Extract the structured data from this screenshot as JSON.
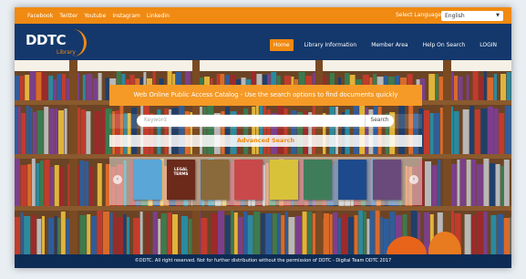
{
  "topbar": {
    "social_links": [
      "Facebook",
      "Twitter",
      "Youtube",
      "Instagram",
      "Linkedin"
    ],
    "language_label": "Select Language",
    "language_value": "English"
  },
  "logo": {
    "word": "DDTC",
    "sub": "Library"
  },
  "nav": {
    "items": [
      "Home",
      "Library Information",
      "Member Area",
      "Help On Search",
      "LOGIN"
    ],
    "active": "Home"
  },
  "banner": {
    "text": "Web Online Public Access Catalog - Use the search options to find documents quickly"
  },
  "search": {
    "placeholder": "Keyword",
    "button": "Search"
  },
  "advanced_search": "Advanced Search",
  "carousel": {
    "books": [
      {
        "title": "",
        "color": "#5aa6d6"
      },
      {
        "title": "LEGAL TERMS",
        "color": "#6b2a1a"
      },
      {
        "title": "",
        "color": "#8a6a3a"
      },
      {
        "title": "",
        "color": "#c9494b"
      },
      {
        "title": "",
        "color": "#d8c23a"
      },
      {
        "title": "",
        "color": "#3f7d5a"
      },
      {
        "title": "",
        "color": "#1d4a8c"
      },
      {
        "title": "",
        "color": "#6a4a7a"
      }
    ]
  },
  "footer": {
    "text": "©DDTC. All right reserved. Not for further distribution without the permission of DDTC - Digital Team DDTC 2017"
  },
  "colors": {
    "accent": "#f08a12",
    "navy": "#14386b",
    "dark_navy": "#0d2c55"
  }
}
